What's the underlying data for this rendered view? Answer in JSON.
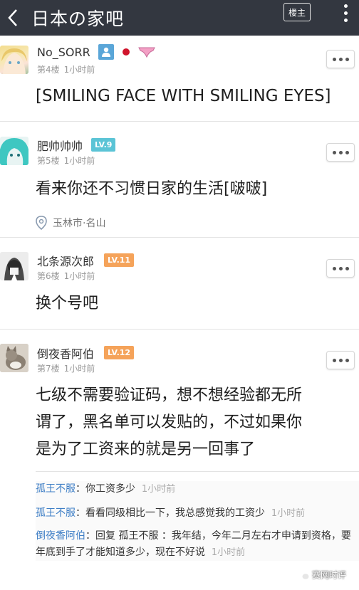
{
  "header": {
    "title": "日本の家吧",
    "louzhu_label": "楼主"
  },
  "posts": [
    {
      "username": "No_SORR",
      "floor": "第4楼",
      "time": "1小时前",
      "content": "[SMILING FACE WITH SMILING EYES]"
    },
    {
      "username": "肥帅帅帅",
      "level": "LV.9",
      "floor": "第5楼",
      "time": "1小时前",
      "content": "看来你还不习惯日家的生活[啵啵]",
      "location": "玉林市·名山"
    },
    {
      "username": "北条源次郎",
      "level": "LV.11",
      "floor": "第6楼",
      "time": "1小时前",
      "content": "换个号吧"
    },
    {
      "username": "倒夜香阿伯",
      "level": "LV.12",
      "floor": "第7楼",
      "time": "1小时前",
      "content_lines": [
        "七级不需要验证码，想不想经验都无所",
        "谓了，黑名单可以发贴的，不过如果你",
        "是为了工资来的就是另一回事了"
      ]
    }
  ],
  "replies": [
    {
      "who": "孤王不服",
      "text": "：你工资多少",
      "time": "1小时前"
    },
    {
      "who": "孤王不服",
      "text": "：看看同级相比一下，我总感觉我的工资少",
      "time": "1小时前"
    },
    {
      "who": "倒夜香阿伯",
      "text": "：回复 孤王不服 ：我年结，今年二月左右才申请到资格，要年底到手了才能知道多少，现在不好说",
      "time": "1小时前"
    }
  ],
  "watermark": "赛网时评",
  "colors": {
    "header_bg": "#333740",
    "level_blue": "#5bc4d6",
    "level_orange": "#f5a35a",
    "reply_name": "#3f7fc6"
  }
}
